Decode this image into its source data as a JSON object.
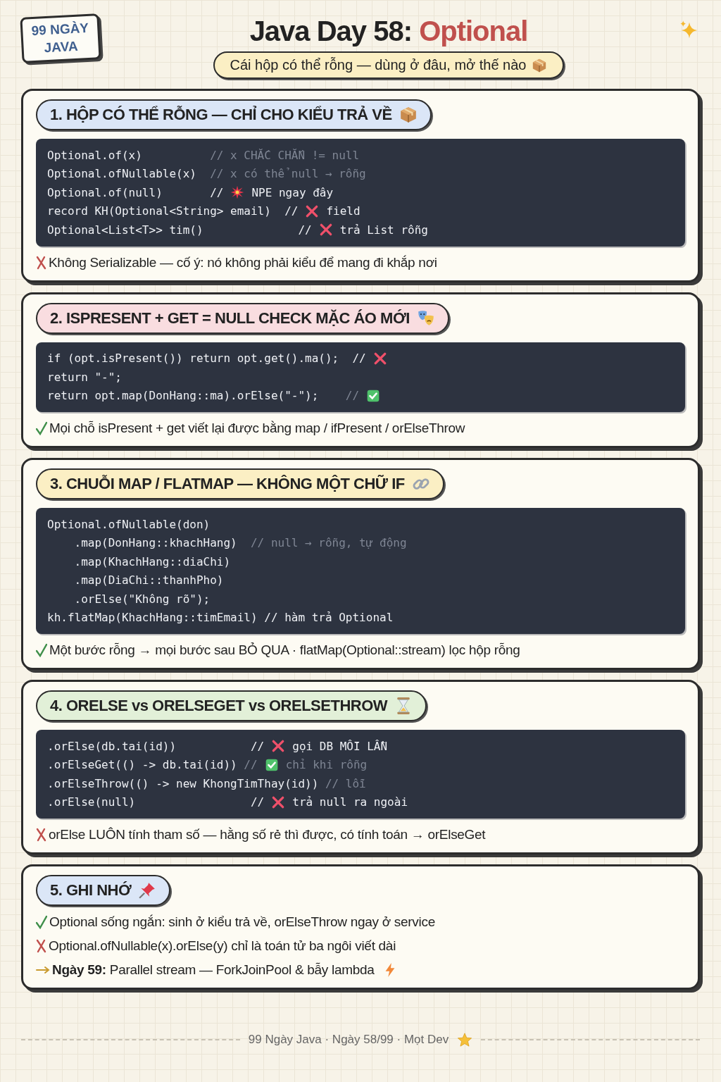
{
  "badge": {
    "lines": [
      "99 NGÀY",
      "JAVA"
    ]
  },
  "title": {
    "lead": "Java Day 58: ",
    "accent": "Optional"
  },
  "subtitle": {
    "text": "Cái hộp có thể rỗng — dùng ở đâu, mở thế nào"
  },
  "sections": [
    {
      "title": "1. HỘP CÓ THỂ RỖNG — CHỈ CHO KIỂU TRẢ VỀ",
      "color": "#dbe6f7",
      "code": [
        {
          "kind": "plain",
          "code": "Optional.of(x)          ",
          "comment": "// x CHẮC CHẮN != null",
          "dim": true
        },
        {
          "kind": "plain",
          "code": "Optional.ofNullable(x)  ",
          "comment": "// x có thể null → rỗng",
          "dim": true
        },
        {
          "kind": "burst",
          "code": "Optional.of(null)       ",
          "comment": "//",
          "note": "NPE ngay đây",
          "dim": false
        },
        {
          "kind": "cross",
          "code": "record KH(Optional<String> email)  ",
          "comment": "//",
          "note": "field",
          "dim": false
        },
        {
          "kind": "cross",
          "code": "Optional<List<T>> tim()              ",
          "comment": "//",
          "note": "trả List rỗng",
          "dim": false
        }
      ],
      "notes": [
        {
          "kind": "bad",
          "text": "Không Serializable — cố ý: nó không phải kiểu để mang đi khắp nơi"
        }
      ]
    },
    {
      "title": "2. ISPRESENT + GET = NULL CHECK MẶC ÁO MỚI",
      "color": "#f9dde0",
      "code": [
        {
          "kind": "cross",
          "code": "if (opt.isPresent()) return opt.get().ma();  ",
          "comment": "//",
          "dim": false
        },
        {
          "kind": "plain",
          "code": "return \"-\";"
        },
        {
          "kind": "check",
          "code": "return opt.map(DonHang::ma).orElse(\"-\");    ",
          "comment": "//",
          "dim": true
        }
      ],
      "notes": [
        {
          "kind": "good",
          "text": "Mọi chỗ isPresent + get viết lại được bằng map / ifPresent / orElseThrow"
        }
      ]
    },
    {
      "title": "3. CHUỖI MAP / FLATMAP — KHÔNG MỘT CHỮ IF",
      "color": "#fbefc4",
      "code": [
        {
          "kind": "plain",
          "code": "Optional.ofNullable(don)"
        },
        {
          "kind": "plain",
          "code": "    .map(DonHang::khachHang)  ",
          "comment": "// null → rỗng, tự động",
          "dim": true
        },
        {
          "kind": "plain",
          "code": "    .map(KhachHang::diaChi)"
        },
        {
          "kind": "plain",
          "code": "    .map(DiaChi::thanhPho)"
        },
        {
          "kind": "plain",
          "code": "    .orElse(\"Không rõ\");"
        },
        {
          "kind": "plain",
          "code": "kh.flatMap(KhachHang::timEmail) ",
          "comment": "// hàm trả Optional",
          "dim": false
        }
      ],
      "notes": [
        {
          "kind": "good",
          "text": "Một bước rỗng → mọi bước sau BỎ QUA · flatMap(Optional::stream) lọc hộp rỗng"
        }
      ]
    },
    {
      "title": "4. ORELSE vs ORELSEGET vs ORELSETHROW",
      "color": "#e2f0d8",
      "code": [
        {
          "kind": "cross",
          "code": ".orElse(db.tai(id))           ",
          "comment": "//",
          "note": "gọi DB MỖI LẦN",
          "dim": false
        },
        {
          "kind": "check",
          "code": ".orElseGet(() -> db.tai(id)) ",
          "comment": "//",
          "note": "chỉ khi rỗng",
          "dim": true
        },
        {
          "kind": "plain",
          "code": ".orElseThrow(() -> new KhongTimThay(id)) ",
          "comment": "// lỗi",
          "dim": true
        },
        {
          "kind": "cross",
          "code": ".orElse(null)                 ",
          "comment": "//",
          "note": "trả null ra ngoài",
          "dim": false
        }
      ],
      "notes": [
        {
          "kind": "bad",
          "text": "orElse LUÔN tính tham số — hằng số rẻ thì được, có tính toán → orElseGet"
        }
      ]
    },
    {
      "title": "5. GHI NHỚ",
      "color": "#dbe6f7",
      "notes": [
        {
          "kind": "good",
          "text": "Optional sống ngắn: sinh ở kiểu trả về, orElseThrow ngay ở service"
        },
        {
          "kind": "bad",
          "text": "Optional.ofNullable(x).orElse(y) chỉ là toán tử ba ngôi viết dài"
        },
        {
          "kind": "next",
          "text": "**Ngày 59:** Parallel stream — ForkJoinPool & bẫy lambda"
        }
      ]
    }
  ],
  "footer": {
    "text": "99 Ngày Java · Ngày 58/99 · Mọt Dev"
  }
}
